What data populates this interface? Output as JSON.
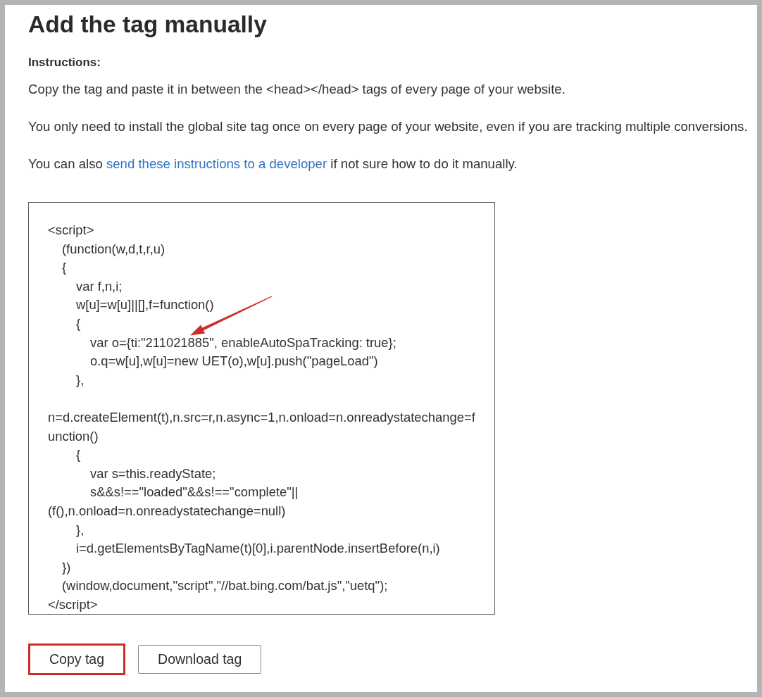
{
  "title": "Add the tag manually",
  "instructions": {
    "heading": "Instructions:",
    "paragraphs": [
      {
        "kind": "plain",
        "text": "Copy the tag and paste it in between the <head></head> tags of every page of your website."
      },
      {
        "kind": "plain",
        "text": "You only need to install the global site tag once on every page of your website, even if you are tracking multiple conversions."
      },
      {
        "kind": "link",
        "text": "You can also ",
        "link": "send these instructions to a developer",
        "after": " if not sure how to do it manually."
      }
    ]
  },
  "code": {
    "blocks": [
      {
        "lines": [
          {
            "text": "<script>",
            "arrow": false
          },
          {
            "text": "    (function(w,d,t,r,u)",
            "arrow": false
          },
          {
            "text": "    {",
            "arrow": false
          },
          {
            "text": "        var f,n,i;",
            "arrow": false
          },
          {
            "text": "        w[u]=w[u]||[],f=function()",
            "arrow": false
          },
          {
            "text": "        {",
            "arrow": false
          },
          {
            "text": "            var o={ti:\"211021885\", enableAutoSpaTracking: true};",
            "arrow": true
          },
          {
            "text": "            o.q=w[u],w[u]=new UET(o),w[u].push(\"pageLoad\")",
            "arrow": false
          },
          {
            "text": "        },",
            "arrow": false
          }
        ]
      },
      {
        "lines": [
          {
            "text": "n=d.createElement(t),n.src=r,n.async=1,n.onload=n.onreadystatechange=f",
            "arrow": false
          },
          {
            "text": "unction()",
            "arrow": false
          },
          {
            "text": "        {",
            "arrow": false
          },
          {
            "text": "            var s=this.readyState;",
            "arrow": false
          },
          {
            "text": "            s&&s!==\"loaded\"&&s!==\"complete\"||",
            "arrow": false
          },
          {
            "text": "(f(),n.onload=n.onreadystatechange=null)",
            "arrow": false
          },
          {
            "text": "        },",
            "arrow": false
          },
          {
            "text": "        i=d.getElementsByTagName(t)[0],i.parentNode.insertBefore(n,i)",
            "arrow": false
          },
          {
            "text": "    })",
            "arrow": false
          },
          {
            "text": "    (window,document,\"script\",\"//bat.bing.com/bat.js\",\"uetq\");",
            "arrow": false
          },
          {
            "text": "</script>",
            "arrow": false
          }
        ]
      }
    ]
  },
  "buttons": [
    {
      "label": "Copy tag",
      "highlighted": true
    },
    {
      "label": "Download tag",
      "highlighted": false
    }
  ]
}
